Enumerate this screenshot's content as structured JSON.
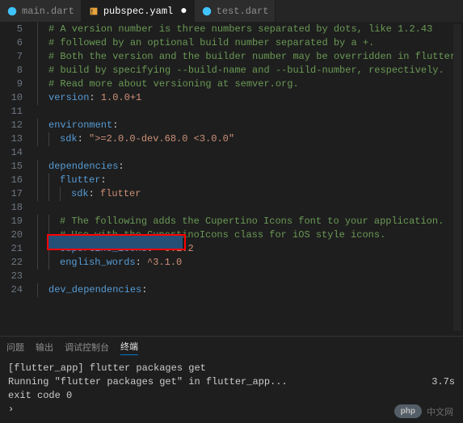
{
  "tabs": {
    "items": [
      {
        "icon": "dart-file-icon",
        "label": "main.dart",
        "active": false,
        "dirty": false
      },
      {
        "icon": "yaml-file-icon",
        "label": "pubspec.yaml",
        "active": true,
        "dirty": true
      },
      {
        "icon": "dart-file-icon",
        "label": "test.dart",
        "active": false,
        "dirty": false
      }
    ]
  },
  "code": {
    "lines": [
      {
        "n": 5,
        "indent": 1,
        "segs": [
          {
            "c": "c-comment",
            "t": "# A version number is three numbers separated by dots, like 1.2.43"
          }
        ]
      },
      {
        "n": 6,
        "indent": 1,
        "segs": [
          {
            "c": "c-comment",
            "t": "# followed by an optional build number separated by a +."
          }
        ]
      },
      {
        "n": 7,
        "indent": 1,
        "segs": [
          {
            "c": "c-comment",
            "t": "# Both the version and the builder number may be overridden in flutter"
          }
        ]
      },
      {
        "n": 8,
        "indent": 1,
        "segs": [
          {
            "c": "c-comment",
            "t": "# build by specifying --build-name and --build-number, respectively."
          }
        ]
      },
      {
        "n": 9,
        "indent": 1,
        "segs": [
          {
            "c": "c-comment",
            "t": "# Read more about versioning at semver.org."
          }
        ]
      },
      {
        "n": 10,
        "indent": 1,
        "segs": [
          {
            "c": "c-key",
            "t": "version"
          },
          {
            "c": "c-punct",
            "t": ": "
          },
          {
            "c": "c-string",
            "t": "1.0.0+1"
          }
        ]
      },
      {
        "n": 11,
        "indent": 0,
        "segs": []
      },
      {
        "n": 12,
        "indent": 1,
        "segs": [
          {
            "c": "c-key",
            "t": "environment"
          },
          {
            "c": "c-punct",
            "t": ":"
          }
        ]
      },
      {
        "n": 13,
        "indent": 2,
        "segs": [
          {
            "c": "c-key",
            "t": "sdk"
          },
          {
            "c": "c-punct",
            "t": ": "
          },
          {
            "c": "c-string",
            "t": "\">=2.0.0-dev.68.0 <3.0.0\""
          }
        ]
      },
      {
        "n": 14,
        "indent": 0,
        "segs": []
      },
      {
        "n": 15,
        "indent": 1,
        "segs": [
          {
            "c": "c-key",
            "t": "dependencies"
          },
          {
            "c": "c-punct",
            "t": ":"
          }
        ]
      },
      {
        "n": 16,
        "indent": 2,
        "segs": [
          {
            "c": "c-key",
            "t": "flutter"
          },
          {
            "c": "c-punct",
            "t": ":"
          }
        ]
      },
      {
        "n": 17,
        "indent": 3,
        "segs": [
          {
            "c": "c-key",
            "t": "sdk"
          },
          {
            "c": "c-punct",
            "t": ": "
          },
          {
            "c": "c-string",
            "t": "flutter"
          }
        ]
      },
      {
        "n": 18,
        "indent": 0,
        "segs": []
      },
      {
        "n": 19,
        "indent": 2,
        "segs": [
          {
            "c": "c-comment",
            "t": "# The following adds the Cupertino Icons font to your application."
          }
        ]
      },
      {
        "n": 20,
        "indent": 2,
        "segs": [
          {
            "c": "c-comment",
            "t": "# Use with the CupertinoIcons class for iOS style icons."
          }
        ]
      },
      {
        "n": 21,
        "indent": 2,
        "segs": [
          {
            "c": "c-key",
            "t": "cupertino_icons"
          },
          {
            "c": "c-punct",
            "t": ": "
          },
          {
            "c": "c-string",
            "t": "^0.1.2"
          }
        ]
      },
      {
        "n": 22,
        "indent": 2,
        "segs": [
          {
            "c": "c-key",
            "t": "english_words"
          },
          {
            "c": "c-punct",
            "t": ": "
          },
          {
            "c": "c-string",
            "t": "^3.1.0"
          }
        ]
      },
      {
        "n": 23,
        "indent": 0,
        "segs": []
      },
      {
        "n": 24,
        "indent": 1,
        "segs": [
          {
            "c": "c-key",
            "t": "dev_dependencies"
          },
          {
            "c": "c-punct",
            "t": ":"
          }
        ]
      }
    ]
  },
  "panel": {
    "tabs": [
      "问题",
      "输出",
      "调试控制台",
      "终端"
    ],
    "active_index": 3
  },
  "terminal": {
    "lines": [
      {
        "text": "[flutter_app] flutter packages get",
        "time": ""
      },
      {
        "text": "Running \"flutter packages get\" in flutter_app...",
        "time": "3.7s"
      },
      {
        "text": "exit code 0",
        "time": ""
      }
    ],
    "caret": "›"
  },
  "watermark": {
    "badge": "php",
    "text": "中文网"
  }
}
